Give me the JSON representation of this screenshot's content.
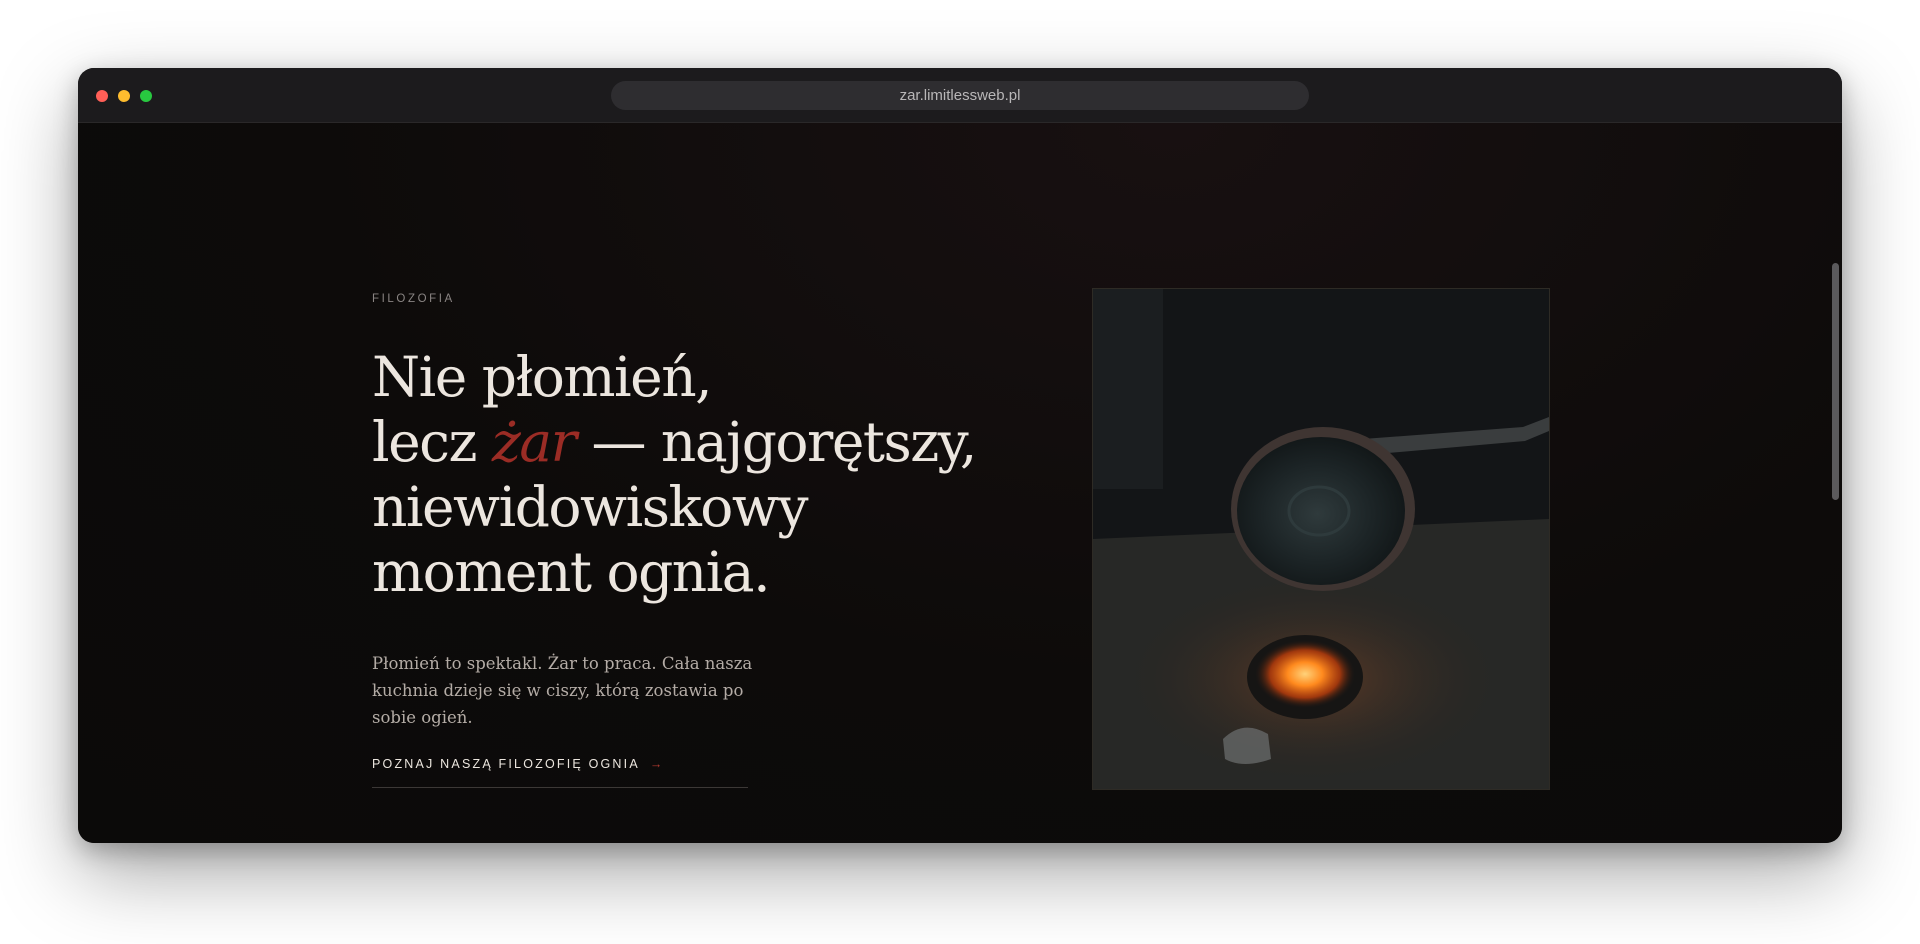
{
  "browser": {
    "url": "zar.limitlessweb.pl"
  },
  "section": {
    "eyebrow": "FILOZOFIA",
    "headline": {
      "line1": "Nie płomień,",
      "line2_before": "lecz ",
      "line2_accent": "żar",
      "line2_after": " — najgorętszy,",
      "line3": "niewidowiskowy",
      "line4": "moment ognia."
    },
    "body": "Płomień to spektakl. Żar to praca. Cała nasza kuchnia dzieje się w ciszy, którą zostawia po sobie ogień.",
    "cta_label": "POZNAJ NASZĄ FILOZOFIĘ OGNIA",
    "cta_arrow": "→"
  },
  "image": {
    "description_icon": "ember-hearth-photo-icon"
  },
  "colors": {
    "accent": "#9b2c25",
    "background": "#0d0b0a",
    "text": "#ece6df"
  }
}
